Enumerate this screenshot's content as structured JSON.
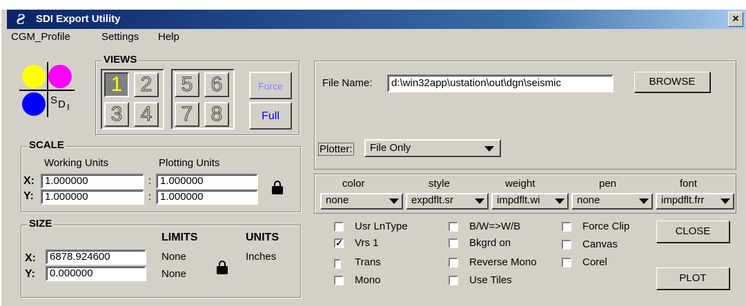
{
  "window": {
    "title": "SDI Export Utility",
    "close_glyph": "×"
  },
  "menu": [
    "CGM_Profile",
    "Settings",
    "Help"
  ],
  "logo": {
    "text_s": "S",
    "text_d": "D",
    "text_i": "I",
    "colors": [
      "#ffff00",
      "#ff00ff",
      "#0000ff"
    ]
  },
  "views": {
    "title": "VIEWS",
    "buttons": [
      "1",
      "2",
      "5",
      "6",
      "3",
      "4",
      "7",
      "8"
    ],
    "force_label": "Force",
    "full_label": "Full"
  },
  "scale": {
    "title": "SCALE",
    "working_units_label": "Working Units",
    "plotting_units_label": "Plotting Units",
    "x_label": "X:",
    "y_label": "Y:",
    "x_working": "1.000000",
    "y_working": "1.000000",
    "x_plotting": "1.000000",
    "y_plotting": "1.000000",
    "separator": ":"
  },
  "size": {
    "title": "SIZE",
    "limits_label": "LIMITS",
    "units_label": "UNITS",
    "x_label": "X:",
    "y_label": "Y:",
    "x_value": "6878.924600",
    "y_value": "0.000000",
    "x_limit": "None",
    "y_limit": "None",
    "units_value": "Inches"
  },
  "file": {
    "label": "File Name:",
    "value": "d:\\win32app\\ustation\\out\\dgn\\seismic",
    "browse_label": "BROWSE"
  },
  "plotter": {
    "label": "Plotter:",
    "value": "File Only"
  },
  "tables": {
    "headers": [
      "color",
      "style",
      "weight",
      "pen",
      "font"
    ],
    "values": [
      "none",
      "expdflt.sr",
      "impdflt.wi",
      "none",
      "impdflt.frr"
    ]
  },
  "options": [
    {
      "label": "Usr LnType",
      "checked": false
    },
    {
      "label": "Vrs 1",
      "checked": true
    },
    {
      "label": "Trans",
      "checked": false
    },
    {
      "label": "Mono",
      "checked": false
    },
    {
      "label": "B/W=>W/B",
      "checked": false
    },
    {
      "label": "Bkgrd on",
      "checked": false
    },
    {
      "label": "Reverse Mono",
      "checked": false
    },
    {
      "label": "Use Tiles",
      "checked": false
    },
    {
      "label": "Force Clip",
      "checked": false
    },
    {
      "label": "Canvas",
      "checked": false
    },
    {
      "label": "Corel",
      "checked": false
    }
  ],
  "actions": {
    "close_label": "CLOSE",
    "plot_label": "PLOT"
  },
  "check_glyph": "✓"
}
